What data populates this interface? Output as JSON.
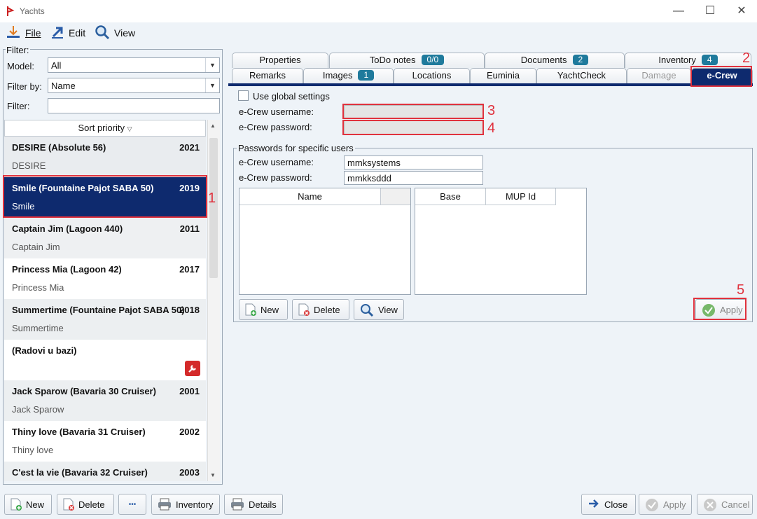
{
  "window": {
    "title": "Yachts"
  },
  "menu": {
    "file": "File",
    "edit": "Edit",
    "view": "View"
  },
  "filter": {
    "group_label": "Filter:",
    "model_label": "Model:",
    "model_value": "All",
    "filter_by_label": "Filter by:",
    "filter_by_value": "Name",
    "filter_label": "Filter:",
    "filter_value": ""
  },
  "list": {
    "sort_header": "Sort priority",
    "items": [
      {
        "name": "DESIRE (Absolute 56)",
        "year": "2021",
        "sub": "DESIRE"
      },
      {
        "name": "Smile (Fountaine Pajot SABA 50)",
        "year": "2019",
        "sub": "Smile"
      },
      {
        "name": "Captain Jim (Lagoon 440)",
        "year": "2011",
        "sub": "Captain Jim"
      },
      {
        "name": "Princess Mia (Lagoon 42)",
        "year": "2017",
        "sub": "Princess Mia"
      },
      {
        "name": "Summertime (Fountaine Pajot SABA 50)",
        "year": "2018",
        "sub": "Summertime"
      },
      {
        "name": " (Radovi u bazi)",
        "year": "",
        "sub": ""
      },
      {
        "name": "Jack Sparow (Bavaria 30 Cruiser)",
        "year": "2001",
        "sub": "Jack Sparow"
      },
      {
        "name": "Thiny love (Bavaria 31 Cruiser)",
        "year": "2002",
        "sub": "Thiny love"
      },
      {
        "name": "C'est la vie (Bavaria 32 Cruiser)",
        "year": "2003",
        "sub": ""
      }
    ]
  },
  "bottom_left": {
    "new": "New",
    "delete": "Delete",
    "more": "•••",
    "inventory": "Inventory",
    "details": "Details"
  },
  "bottom_right": {
    "close": "Close",
    "apply": "Apply",
    "cancel": "Cancel"
  },
  "tabs_top": [
    {
      "label": "Properties",
      "badge": ""
    },
    {
      "label": "ToDo notes",
      "badge": "0/0"
    },
    {
      "label": "Documents",
      "badge": "2"
    },
    {
      "label": "Inventory",
      "badge": "4"
    }
  ],
  "tabs_bottom": [
    {
      "label": "Remarks",
      "badge": ""
    },
    {
      "label": "Images",
      "badge": "1"
    },
    {
      "label": "Locations",
      "badge": ""
    },
    {
      "label": "Euminia",
      "badge": ""
    },
    {
      "label": "YachtCheck",
      "badge": ""
    },
    {
      "label": "Damage",
      "badge": ""
    },
    {
      "label": "e-Crew",
      "badge": ""
    }
  ],
  "ecrew": {
    "use_global": "Use global settings",
    "username_label": "e-Crew username:",
    "password_label": "e-Crew password:",
    "specific_group": "Passwords for specific users",
    "specific_username_label": "e-Crew username:",
    "specific_username": "mmksystems",
    "specific_password_label": "e-Crew password:",
    "specific_password": "mmkksddd",
    "table1_col": "Name",
    "table2_col1": "Base",
    "table2_col2": "MUP Id",
    "new": "New",
    "delete": "Delete",
    "view": "View",
    "apply": "Apply"
  },
  "annotations": [
    "1",
    "2",
    "3",
    "4",
    "5"
  ],
  "colors": {
    "selected_row": "#0e2a6e",
    "annotation": "#e0313d",
    "badge": "#1f7a9c"
  }
}
